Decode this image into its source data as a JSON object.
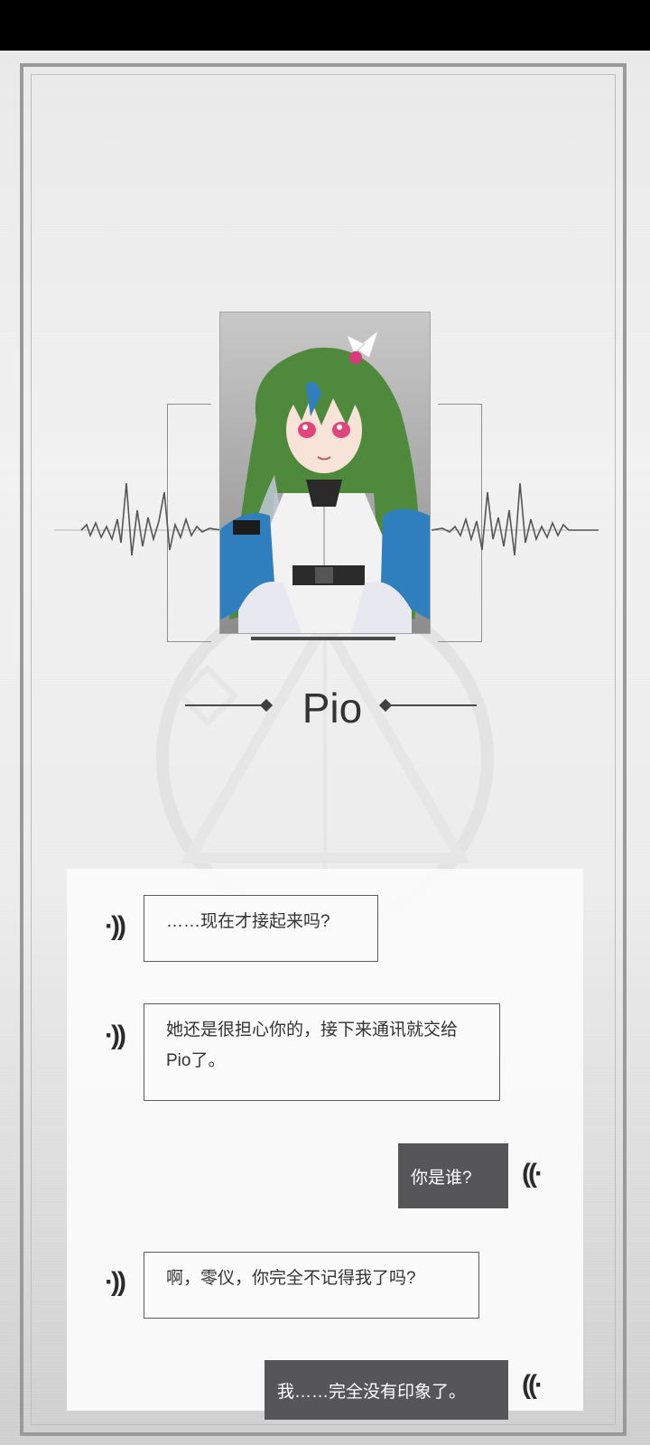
{
  "speaker": {
    "name": "Pio"
  },
  "messages": [
    {
      "side": "incoming",
      "text": "……现在才接起来吗?"
    },
    {
      "side": "incoming",
      "text": "她还是很担心你的，接下来通讯就交给Pio了。"
    },
    {
      "side": "outgoing",
      "text": "你是谁?"
    },
    {
      "side": "incoming",
      "text": "啊，零仪，你完全不记得我了吗?"
    },
    {
      "side": "outgoing",
      "text": "我……完全没有印象了。"
    }
  ],
  "icons": {
    "incoming": "sound-wave-right-icon",
    "outgoing": "sound-wave-left-icon"
  },
  "colors": {
    "outgoing_bubble": "#565659",
    "accent_blue": "#2f7fbf",
    "hair_green": "#4f8a3c"
  }
}
